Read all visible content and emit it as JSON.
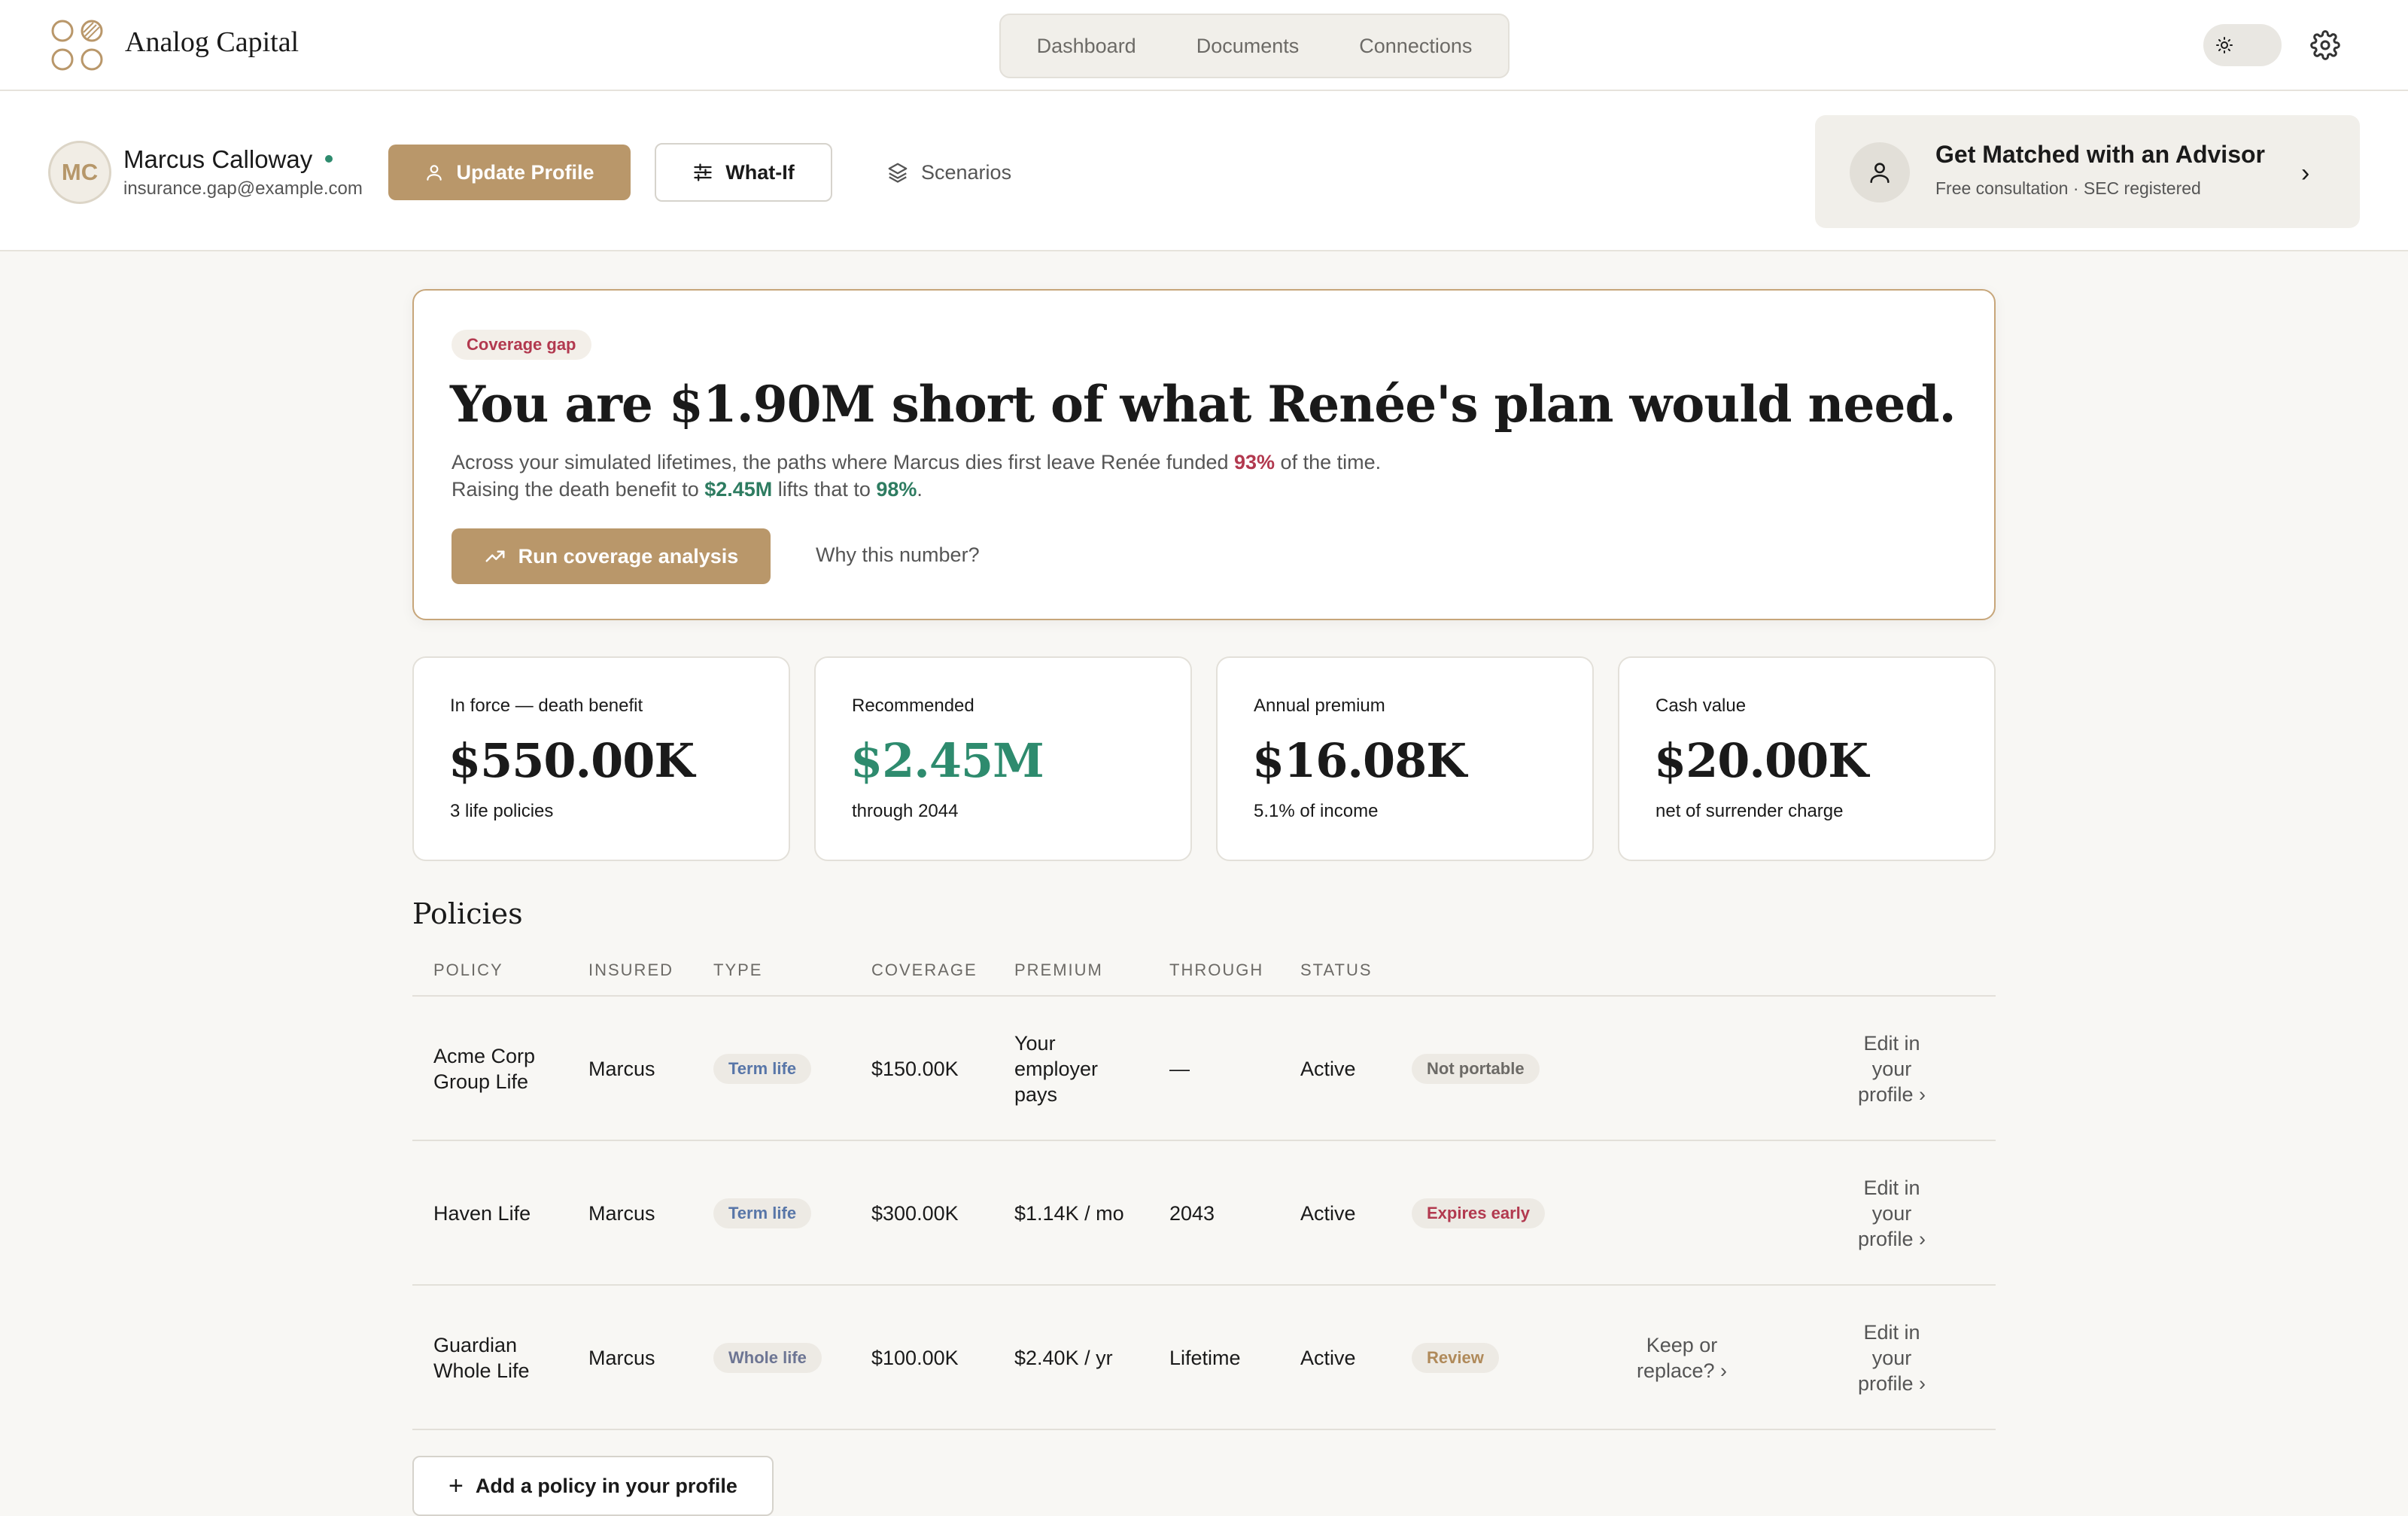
{
  "app": {
    "brand": "Analog Capital",
    "nav_tabs": [
      "Dashboard",
      "Documents",
      "Connections"
    ],
    "theme_icon": "sun-icon",
    "settings_icon": "gear-icon"
  },
  "profile": {
    "initials": "MC",
    "name": "Marcus Calloway",
    "email": "insurance.gap@example.com",
    "status_color": "#2e8b6e",
    "update_label": "Update Profile",
    "whatif_label": "What-If",
    "scenarios_label": "Scenarios"
  },
  "advisor": {
    "title": "Get Matched with an Advisor",
    "subtitle": "Free consultation · SEC registered"
  },
  "hero": {
    "badge": "Coverage gap",
    "headline": "You are $1.90M short of what Renée's plan would need.",
    "body_1": "Across your simulated lifetimes, the paths where Marcus dies first leave Renée funded ",
    "pct_now": "93%",
    "body_2": " of the time. Raising the death benefit to ",
    "target": "$2.45M",
    "body_3": " lifts that to ",
    "pct_target": "98%",
    "body_4": ".",
    "run_label": "Run coverage analysis",
    "why_label": "Why this number?"
  },
  "stats": [
    {
      "label": "In force — death benefit",
      "value": "$550.00K",
      "sub": "3 life policies"
    },
    {
      "label": "Recommended",
      "value": "$2.45M",
      "sub": "through 2044"
    },
    {
      "label": "Annual premium",
      "value": "$16.08K",
      "sub": "5.1% of income"
    },
    {
      "label": "Cash value",
      "value": "$20.00K",
      "sub": "net of surrender charge"
    }
  ],
  "policies": {
    "title": "Policies",
    "columns": [
      "POLICY",
      "INSURED",
      "TYPE",
      "COVERAGE",
      "PREMIUM",
      "THROUGH",
      "STATUS"
    ],
    "rows": [
      {
        "policy": "Acme Corp Group Life",
        "insured": "Marcus",
        "type": "Term life",
        "coverage": "$150.00K",
        "premium": "Your employer pays",
        "through": "—",
        "status": "Active",
        "flag": "Not portable",
        "action": "",
        "edit": "Edit in your profile ›"
      },
      {
        "policy": "Haven Life",
        "insured": "Marcus",
        "type": "Term life",
        "coverage": "$300.00K",
        "premium": "$1.14K / mo",
        "through": "2043",
        "status": "Active",
        "flag": "Expires early",
        "action": "",
        "edit": "Edit in your profile ›"
      },
      {
        "policy": "Guardian Whole Life",
        "insured": "Marcus",
        "type": "Whole life",
        "coverage": "$100.00K",
        "premium": "$2.40K / yr",
        "through": "Lifetime",
        "status": "Active",
        "flag": "Review",
        "action": "Keep or replace? ›",
        "edit": "Edit in your profile ›"
      }
    ],
    "add_label": "Add a policy in your profile"
  }
}
